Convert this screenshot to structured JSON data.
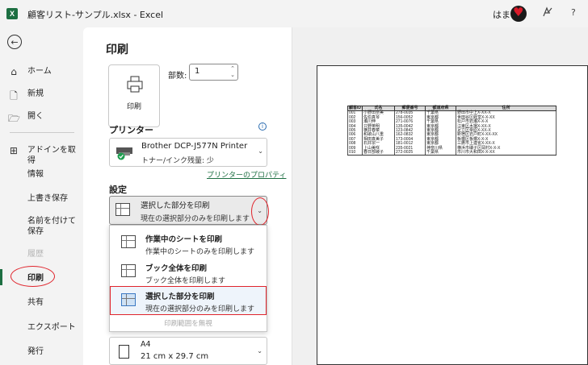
{
  "titlebar": {
    "app_icon": "X",
    "title": "顧客リスト-サンプル.xlsx  -  Excel",
    "user_name": "はま",
    "copilot_icon": "copilot-icon",
    "help": "?"
  },
  "sidebar": {
    "back_icon": "←",
    "items": [
      {
        "label": "ホーム",
        "icon": "⌂"
      },
      {
        "label": "新規",
        "icon": "🗋"
      },
      {
        "label": "開く",
        "icon": "🗁"
      },
      {
        "label": "アドインを取得",
        "icon": "⊞"
      },
      {
        "label": "情報"
      },
      {
        "label": "上書き保存"
      },
      {
        "label": "名前を付けて保存"
      },
      {
        "label": "履歴"
      },
      {
        "label": "印刷"
      },
      {
        "label": "共有"
      },
      {
        "label": "エクスポート"
      },
      {
        "label": "発行"
      }
    ]
  },
  "main": {
    "title": "印刷",
    "print_button": "印刷",
    "copies_label": "部数:",
    "copies_value": "1",
    "printer_section": "プリンター",
    "info_icon": "i",
    "printer_name": "Brother DCP-J577N Printer",
    "printer_status": "トナー/インク残量: 少",
    "printer_properties": "プリンターのプロパティ",
    "settings_section": "設定",
    "selected_option_title": "選択した部分を印刷",
    "selected_option_sub": "現在の選択部分のみを印刷します",
    "menu_options": [
      {
        "title": "作業中のシートを印刷",
        "sub": "作業中のシートのみを印刷します"
      },
      {
        "title": "ブック全体を印刷",
        "sub": "ブック全体を印刷します"
      },
      {
        "title": "選択した部分を印刷",
        "sub": "現在の選択部分のみを印刷します"
      }
    ],
    "ignore_print_area": "印刷範囲を無視",
    "paper_size": "A4",
    "paper_dims": "21 cm x 29.7 cm",
    "chevron": "⌄"
  },
  "preview": {
    "headers": [
      "顧客ID",
      "氏名",
      "郵便番号",
      "都道府県",
      "住所"
    ],
    "rows": [
      [
        "001",
        "小野田奈美",
        "278-0035",
        "千葉県",
        "野田市中上X-XX-X"
      ],
      [
        "002",
        "佐伯真琴",
        "156-0052",
        "東京都",
        "世田谷区経堂X-X-XX"
      ],
      [
        "003",
        "瀬川伸",
        "271-0076",
        "千葉県",
        "松戸市岩瀬X-X-X"
      ],
      [
        "004",
        "只野英明",
        "135-0042",
        "東京都",
        "江東区木場X-XX-X"
      ],
      [
        "005",
        "横井春菜",
        "123-0842",
        "東京都",
        "足立区栗原X-XX-X"
      ],
      [
        "006",
        "和歌山八重",
        "162-0832",
        "東京都",
        "新宿区岩戸町X-XX-XX"
      ],
      [
        "007",
        "相田真美子",
        "173-0004",
        "東京都",
        "板橋区板橋X-X-X"
      ],
      [
        "008",
        "石井宗一",
        "181-0012",
        "東京都",
        "三鷹市上連雀X-XX-X"
      ],
      [
        "009",
        "上山美咲",
        "235-0021",
        "神奈川県",
        "横浜市磯子区岡村X-X-X"
      ],
      [
        "010",
        "春日部綾子",
        "272-0025",
        "千葉県",
        "市川市大和田X-X-XX"
      ]
    ]
  }
}
